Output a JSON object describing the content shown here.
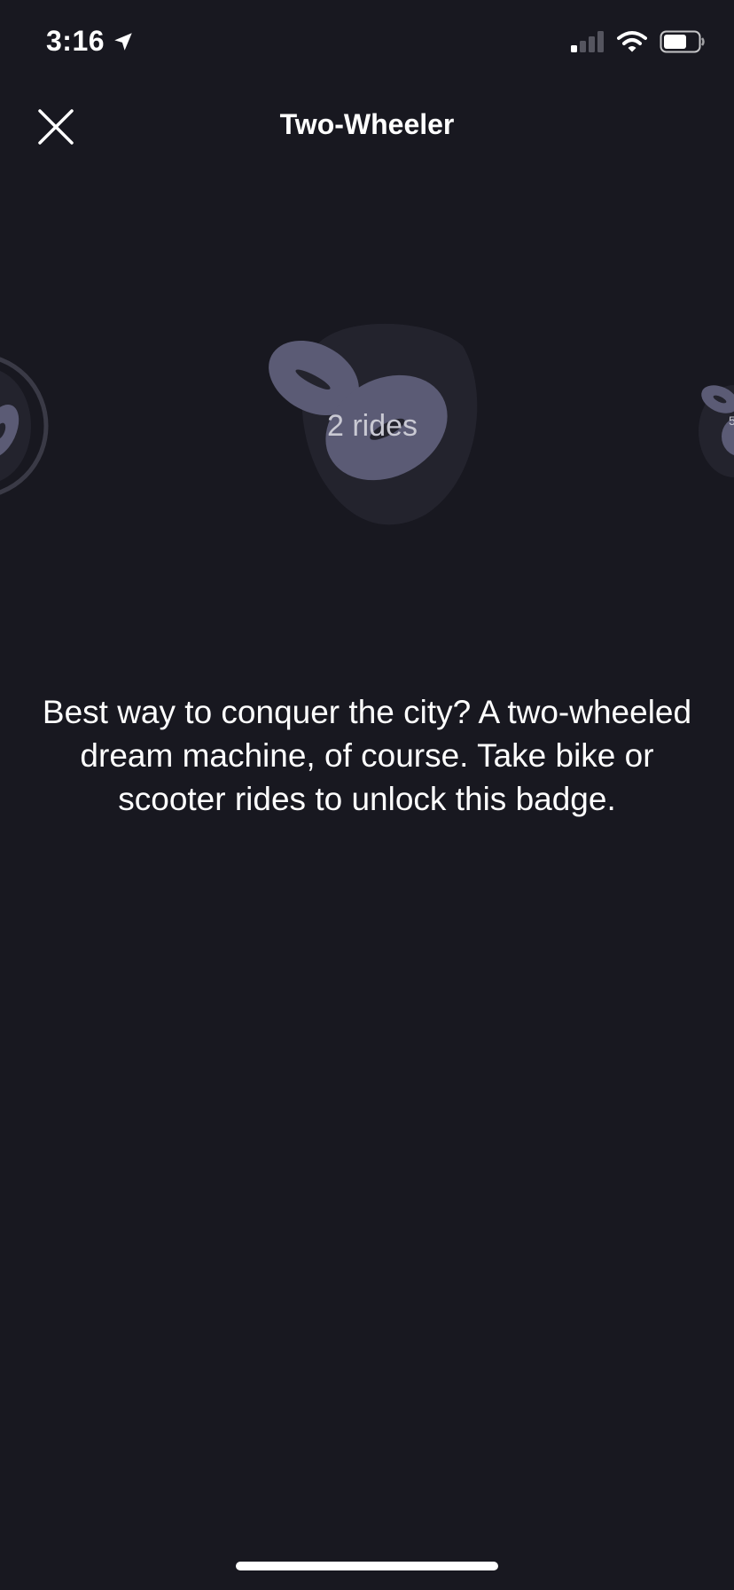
{
  "status_bar": {
    "time": "3:16",
    "icons": [
      "location-arrow-icon",
      "cellular-signal-icon",
      "wifi-icon",
      "battery-icon"
    ]
  },
  "header": {
    "title": "Two-Wheeler",
    "close_icon": "close-icon"
  },
  "carousel": {
    "current_badge": {
      "label": "2 rides",
      "icon": "two-wheel-badge-icon"
    },
    "next_badge_partial_label": "5"
  },
  "description": "Best way to conquer the city? A two-wheeled dream machine, of course. Take bike or scooter rides to unlock this badge.",
  "colors": {
    "background": "#181820",
    "badge_blob": "#23232d",
    "badge_wheel": "#5b5b75",
    "text": "#ffffff",
    "badge_label": "#c9c9d3"
  }
}
